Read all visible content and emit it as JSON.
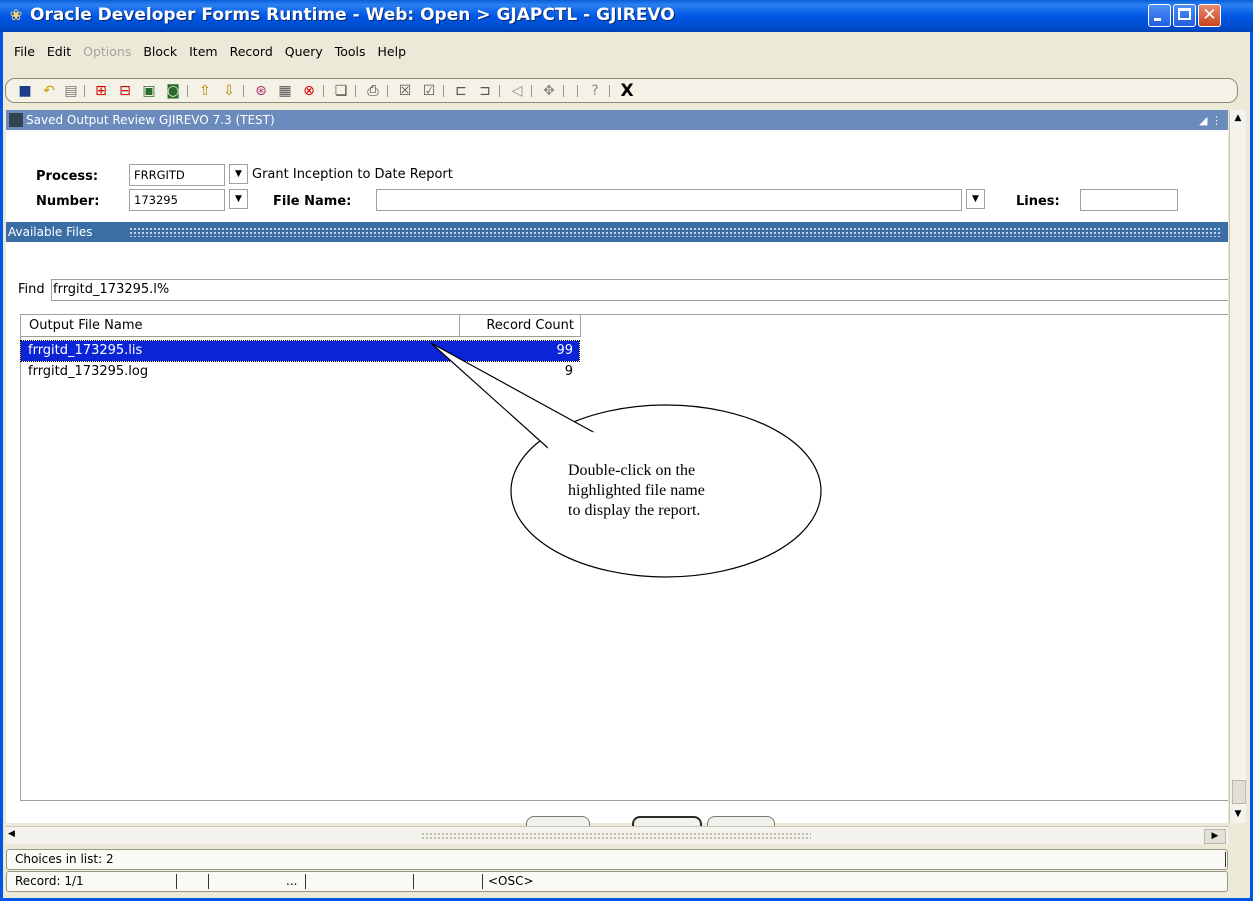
{
  "window": {
    "title": "Oracle Developer Forms Runtime - Web:  Open > GJAPCTL - GJIREVO",
    "minimize_glyph": "_",
    "maximize_glyph": "□",
    "close_glyph": "✕"
  },
  "menu": [
    {
      "label": "File",
      "disabled": false
    },
    {
      "label": "Edit",
      "disabled": false
    },
    {
      "label": "Options",
      "disabled": true
    },
    {
      "label": "Block",
      "disabled": false
    },
    {
      "label": "Item",
      "disabled": false
    },
    {
      "label": "Record",
      "disabled": false
    },
    {
      "label": "Query",
      "disabled": false
    },
    {
      "label": "Tools",
      "disabled": false
    },
    {
      "label": "Help",
      "disabled": false
    }
  ],
  "toolbar": {
    "exit_label": "X",
    "icons": [
      "save-icon",
      "rollback-icon",
      "select-icon",
      "insert-record-icon",
      "remove-record-icon",
      "previous-block-icon",
      "next-block-icon",
      "enter-query-icon",
      "execute-query-icon",
      "cancel-query-icon",
      "clear-record-icon",
      "count-hits-icon",
      "duplicate-icon",
      "print-icon",
      "export-icon",
      "import-icon",
      "previous-item-icon",
      "next-item-icon",
      "audio-icon",
      "maximize-icon",
      "help-icon"
    ]
  },
  "form": {
    "header_title": "Saved Output Review  GJIREVO  7.3  (TEST)",
    "process_label": "Process:",
    "process_value": "FRRGITD",
    "process_description": "Grant Inception to Date Report",
    "number_label": "Number:",
    "number_value": "173295",
    "file_name_label": "File Name:",
    "file_name_value": "",
    "lines_label": "Lines:",
    "lines_value": "",
    "dropdown_glyph": "▼"
  },
  "available_files": {
    "block_title": "Available Files",
    "find_label": "Find",
    "find_value": "frrgitd_173295.l%",
    "columns": [
      "Output File Name",
      "Record Count"
    ],
    "rows": [
      {
        "name": "frrgitd_173295.lis",
        "count": "99",
        "selected": true
      },
      {
        "name": "frrgitd_173295.log",
        "count": "9",
        "selected": false
      }
    ]
  },
  "callout": {
    "line1": "Double-click on the",
    "line2": "highlighted file name",
    "line3": "to display the report."
  },
  "status": {
    "message": "Choices in list: 2",
    "record": "Record: 1/1",
    "ellipsis": "...",
    "mode": "<OSC>"
  }
}
